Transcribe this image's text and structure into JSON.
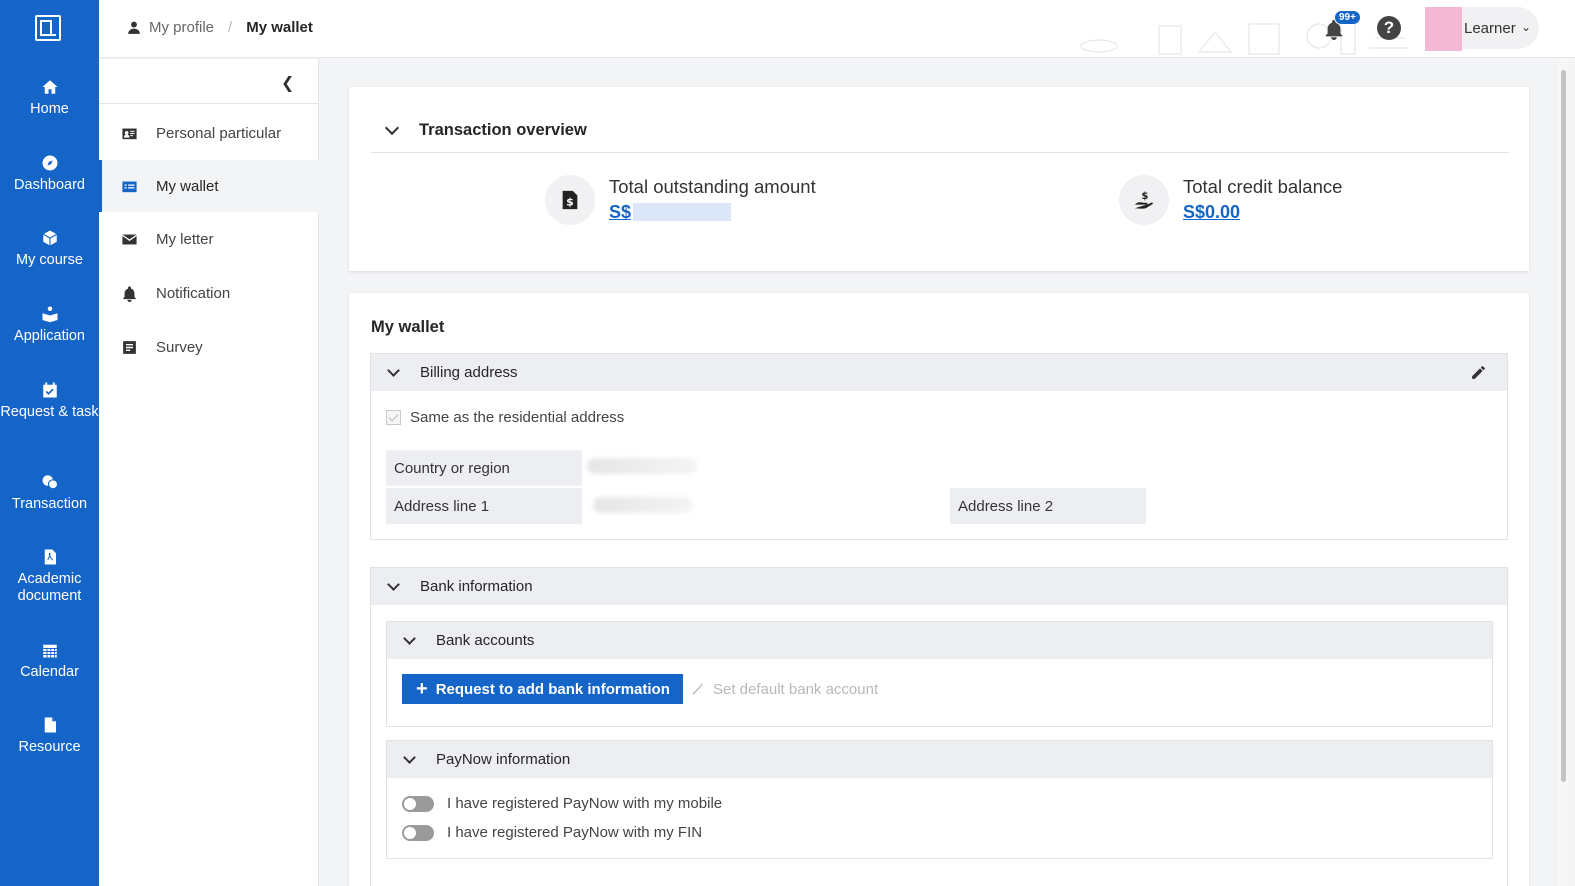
{
  "rail": {
    "items": [
      {
        "label": "Home",
        "icon": "home-icon"
      },
      {
        "label": "Dashboard",
        "icon": "compass-icon"
      },
      {
        "label": "My course",
        "icon": "cube-icon"
      },
      {
        "label": "Application",
        "icon": "application-icon"
      },
      {
        "label": "Request & task",
        "icon": "calendar-check-icon"
      },
      {
        "label": "Transaction",
        "icon": "coins-icon"
      },
      {
        "label": "Academic document",
        "icon": "pdf-file-icon"
      },
      {
        "label": "Calendar",
        "icon": "calendar-icon"
      },
      {
        "label": "Resource",
        "icon": "file-icon"
      }
    ]
  },
  "header": {
    "breadcrumb_root": "My profile",
    "breadcrumb_sep": "/",
    "breadcrumb_current": "My wallet",
    "notification_badge": "99+",
    "help_glyph": "?",
    "user_name": "Learner"
  },
  "subnav": {
    "items": [
      {
        "label": "Personal particular",
        "icon": "id-card-icon"
      },
      {
        "label": "My wallet",
        "icon": "wallet-card-icon",
        "active": true
      },
      {
        "label": "My letter",
        "icon": "envelope-icon"
      },
      {
        "label": "Notification",
        "icon": "bell-icon"
      },
      {
        "label": "Survey",
        "icon": "survey-icon"
      }
    ]
  },
  "overview": {
    "title": "Transaction overview",
    "outstanding_label": "Total outstanding amount",
    "outstanding_currency": "S$",
    "credit_label": "Total credit balance",
    "credit_value": "S$0.00"
  },
  "wallet": {
    "title": "My wallet",
    "billing": {
      "title": "Billing address",
      "same_as_label": "Same as the residential address",
      "country_label": "Country or region",
      "address1_label": "Address line 1",
      "address2_label": "Address line 2"
    },
    "bank": {
      "title": "Bank information",
      "accounts_title": "Bank accounts",
      "add_button_label": "Request to add bank information",
      "default_button_label": "Set default bank account",
      "paynow_title": "PayNow information",
      "paynow_mobile_label": "I have registered PayNow with my mobile",
      "paynow_fin_label": "I have registered PayNow with my FIN",
      "paynow_mobile_on": false,
      "paynow_fin_on": false
    }
  },
  "colors": {
    "brand": "#1565c8",
    "panel_header": "#eceef1"
  }
}
